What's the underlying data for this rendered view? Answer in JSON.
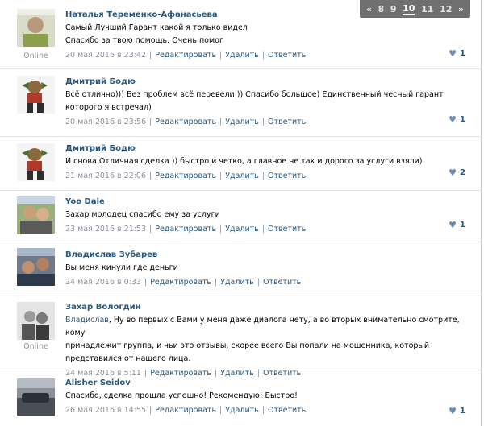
{
  "pager": {
    "prev": "«",
    "pages": [
      "8",
      "9",
      "10",
      "11",
      "12"
    ],
    "current": "10",
    "next": "»"
  },
  "common": {
    "edit": "Редактировать",
    "delete": "Удалить",
    "reply": "Ответить",
    "sep": "|"
  },
  "comments": [
    {
      "author": "Наталья Теременко-Афанасьева",
      "lines": [
        "Самый Лучший Гарант какой я только видел",
        "Спасибо за твою помощь. Очень помог"
      ],
      "date": "20 мая 2016 в 23:42",
      "likes": "1",
      "online": "Online"
    },
    {
      "author": "Дмитрий Бодю",
      "lines": [
        "Всё отлично))) Без проблем всё перевели )) Спасибо большое) Единственный чесный гарант",
        "которого я встречал)"
      ],
      "date": "20 мая 2016 в 23:56",
      "likes": "1"
    },
    {
      "author": "Дмитрий Бодю",
      "lines": [
        "И снова Отличная сделка )) быстро и четко, а главное не так и дорого за услуги взяли)"
      ],
      "date": "21 мая 2016 в 22:06",
      "likes": "2"
    },
    {
      "author": "Yoo Dale",
      "lines": [
        "Захар молодец спасибо ему за услуги"
      ],
      "date": "23 мая 2016 в 21:53",
      "likes": "1"
    },
    {
      "author": "Владислав Зубарев",
      "lines": [
        "Вы меня кинули где деньги"
      ],
      "date": "24 мая 2016 в 0:33"
    },
    {
      "author": "Захар Вологдин",
      "mention": "Владислав",
      "lines": [
        ", Ну во первых с Вами у меня даже диалога нету, а во вторых внимательно смотрите, кому",
        "принадлежит группа, и чьи это отзывы, скорее всего Вы попали на мошенника, который",
        "представился от нашего лица."
      ],
      "date": "24 мая 2016 в 5:11",
      "online": "Online"
    },
    {
      "author": "Alisher Seidov",
      "lines": [
        "Спасибо, сделка прошла успешно! Рекомендую! Быстро!"
      ],
      "date": "26 мая 2016 в 14:55",
      "likes": "1"
    }
  ]
}
